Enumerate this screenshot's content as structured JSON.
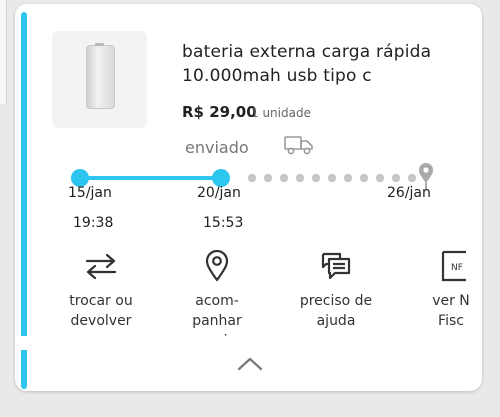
{
  "colors": {
    "accent": "#2cc6f0",
    "pending_dot": "#c7c7c7",
    "icon": "#333333"
  },
  "product": {
    "image_icon": "power-bank-image",
    "title_line1": "bateria externa carga rápida",
    "title_line2": "10.000mah usb tipo c",
    "price": "R$ 29,00",
    "quantity": "1 unidade"
  },
  "shipment": {
    "status": "enviado",
    "status_icon": "truck-icon",
    "progress_fraction": 0.3,
    "steps": [
      {
        "date": "15/jan",
        "time": "19:38",
        "state": "done"
      },
      {
        "date": "20/jan",
        "time": "15:53",
        "state": "current"
      },
      {
        "date": "26/jan",
        "time": "",
        "state": "expected",
        "icon": "location-pin-icon"
      }
    ]
  },
  "actions": [
    {
      "icon": "swap-arrows-icon",
      "label_line1": "trocar ou",
      "label_line2": "devolver",
      "label_line3": ""
    },
    {
      "icon": "location-pin-icon",
      "label_line1": "acom-",
      "label_line2": "panhar",
      "label_line3": "envio"
    },
    {
      "icon": "chat-bubbles-icon",
      "label_line1": "preciso de",
      "label_line2": "ajuda",
      "label_line3": ""
    },
    {
      "icon": "invoice-icon",
      "label_line1": "ver N",
      "label_line2": "Fisc",
      "label_line3": ""
    }
  ],
  "collapse_icon": "chevron-up-icon"
}
